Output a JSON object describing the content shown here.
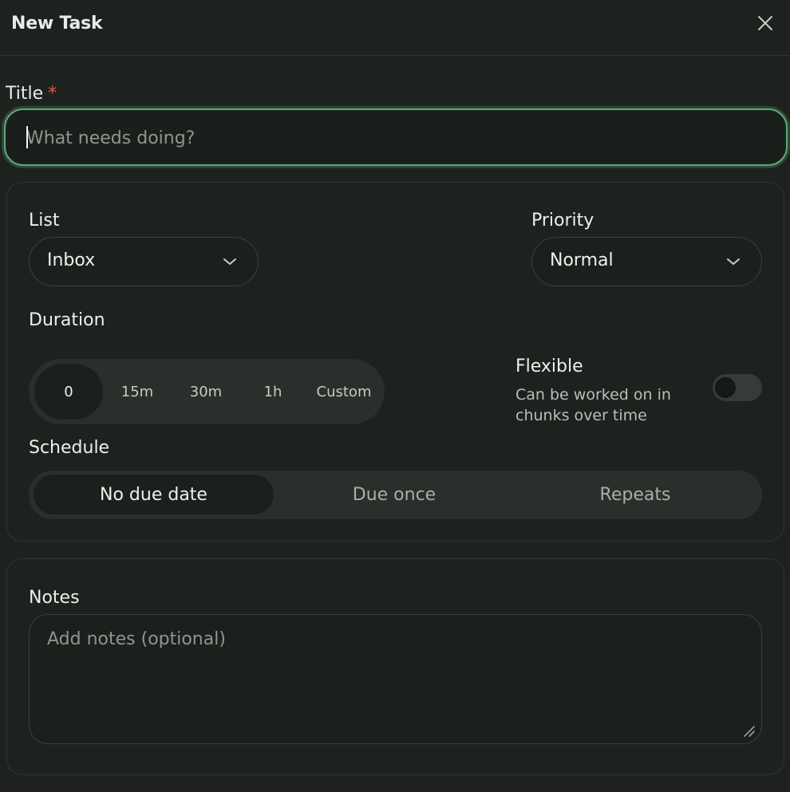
{
  "header": {
    "title": "New Task",
    "close_icon": "close-icon"
  },
  "title_field": {
    "label": "Title",
    "required_mark": "*",
    "placeholder": "What needs doing?",
    "value": ""
  },
  "list_field": {
    "label": "List",
    "value": "Inbox",
    "icon": "chevron-down-icon"
  },
  "priority_field": {
    "label": "Priority",
    "value": "Normal",
    "icon": "chevron-down-icon"
  },
  "duration": {
    "label": "Duration",
    "options": [
      "0",
      "15m",
      "30m",
      "1h",
      "Custom"
    ],
    "selected": "0"
  },
  "flexible": {
    "label": "Flexible",
    "description": "Can be worked on in chunks over time",
    "enabled": false
  },
  "schedule": {
    "label": "Schedule",
    "options": [
      "No due date",
      "Due once",
      "Repeats"
    ],
    "selected": "No due date"
  },
  "notes": {
    "label": "Notes",
    "placeholder": "Add notes (optional)",
    "value": ""
  },
  "colors": {
    "background": "#1e221f",
    "accent_focus": "#5fa877",
    "required": "#e5534b"
  }
}
